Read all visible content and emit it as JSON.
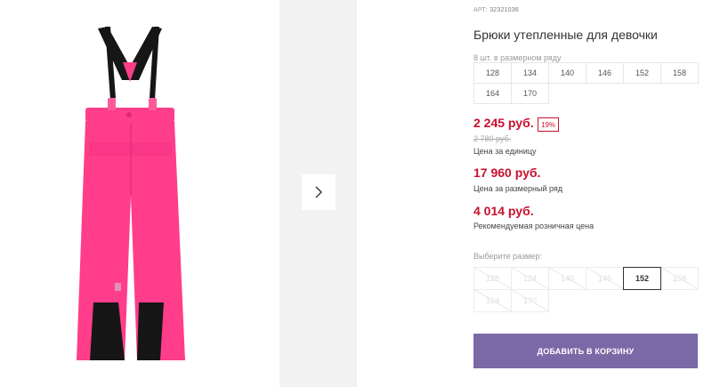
{
  "product": {
    "art_label": "АРТ:",
    "art_number": "32321036",
    "title": "Брюки утепленные для девочки",
    "image_icon": "snow-pants-image"
  },
  "pack": {
    "note": "8 шт. в размерном ряду",
    "sizes_row1": [
      "128",
      "134",
      "140",
      "146",
      "152",
      "158"
    ],
    "sizes_row2": [
      "164",
      "170"
    ]
  },
  "pricing": {
    "price": "2 245 руб.",
    "discount": "19%",
    "old_price": "2 780 руб.",
    "unit_note": "Цена за единицу",
    "pack_price": "17 960 руб.",
    "pack_note": "Цена за размерный ряд",
    "retail_price": "4 014 руб.",
    "retail_note": "Рекомендуемая розничная цена"
  },
  "size_picker": {
    "label": "Выберите размер:",
    "row1": [
      "128",
      "134",
      "140",
      "146",
      "152",
      "158"
    ],
    "row2": [
      "164",
      "170"
    ],
    "selected": "152"
  },
  "cart": {
    "add_label": "ДОБАВИТЬ В КОРЗИНУ"
  },
  "colors": {
    "accent_price": "#c8102e",
    "button": "#7b68a6",
    "product_pink": "#ff3d8a"
  },
  "icons": {
    "next": "chevron-right-icon"
  }
}
